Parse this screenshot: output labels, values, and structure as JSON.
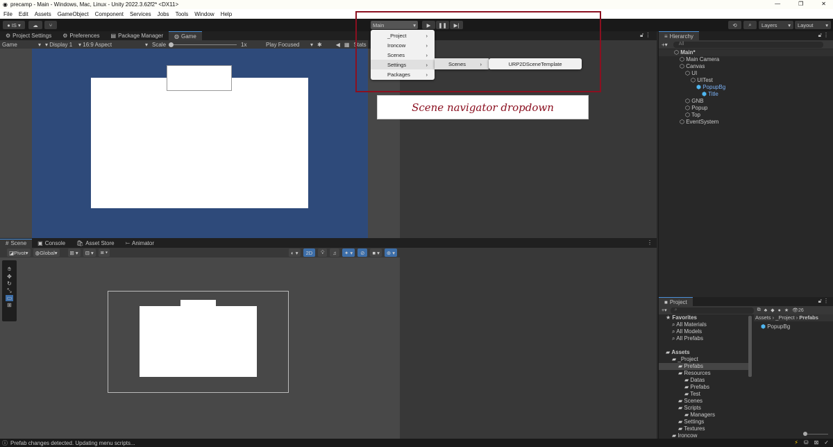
{
  "window": {
    "title": "precamp - Main - Windows, Mac, Linux - Unity 2022.3.62f2* <DX11>",
    "controls": [
      "—",
      "❐",
      "✕"
    ]
  },
  "menubar": [
    "File",
    "Edit",
    "Assets",
    "GameObject",
    "Component",
    "Services",
    "Jobs",
    "Tools",
    "Window",
    "Help"
  ],
  "toolbar": {
    "account": "IS",
    "scene_dropdown": "Main",
    "layers": "Layers",
    "layout": "Layout"
  },
  "top_tabs": [
    "Project Settings",
    "Preferences",
    "Package Manager",
    "Game"
  ],
  "game_toolbar": {
    "view": "Game",
    "display": "Display 1",
    "aspect": "16:9 Aspect",
    "scale_label": "Scale",
    "scale_value": "1x",
    "play_mode": "Play Focused",
    "stats": "Stats"
  },
  "scene_menu": {
    "items": [
      "_Project",
      "Ironcow",
      "Scenes",
      "Settings",
      "Packages"
    ],
    "highlighted": "Settings",
    "submenu": [
      "Scenes"
    ],
    "subsubmenu": [
      "URP2DSceneTemplate"
    ]
  },
  "annotation": {
    "label": "Scene navigator dropdown",
    "color": "#8b1020"
  },
  "hierarchy": {
    "title": "Hierarchy",
    "search_placeholder": "All",
    "items": [
      {
        "label": "Main*",
        "depth": 0,
        "bold": true
      },
      {
        "label": "Main Camera",
        "depth": 1
      },
      {
        "label": "Canvas",
        "depth": 1
      },
      {
        "label": "UI",
        "depth": 2
      },
      {
        "label": "UITest",
        "depth": 3
      },
      {
        "label": "PopupBg",
        "depth": 4,
        "prefab": true
      },
      {
        "label": "Title",
        "depth": 5,
        "prefab": true
      },
      {
        "label": "GNB",
        "depth": 2
      },
      {
        "label": "Popup",
        "depth": 2
      },
      {
        "label": "Top",
        "depth": 2
      },
      {
        "label": "EventSystem",
        "depth": 1
      }
    ]
  },
  "bottom_tabs": [
    "Scene",
    "Console",
    "Asset Store",
    "Animator"
  ],
  "scene_toolbar": {
    "pivot": "Pivot",
    "global": "Global",
    "mode_2d": "2D"
  },
  "project": {
    "title": "Project",
    "count": "26",
    "breadcrumb": [
      "Assets",
      "_Project",
      "Prefabs"
    ],
    "files": [
      "PopupBg"
    ],
    "tree": [
      {
        "label": "Favorites",
        "depth": 0,
        "bold": true
      },
      {
        "label": "All Materials",
        "depth": 1
      },
      {
        "label": "All Models",
        "depth": 1
      },
      {
        "label": "All Prefabs",
        "depth": 1
      },
      {
        "label": "",
        "depth": 0
      },
      {
        "label": "Assets",
        "depth": 0,
        "bold": true
      },
      {
        "label": "_Project",
        "depth": 1
      },
      {
        "label": "Prefabs",
        "depth": 2,
        "selected": true
      },
      {
        "label": "Resources",
        "depth": 2
      },
      {
        "label": "Datas",
        "depth": 3
      },
      {
        "label": "Prefabs",
        "depth": 3
      },
      {
        "label": "Test",
        "depth": 3
      },
      {
        "label": "Scenes",
        "depth": 2
      },
      {
        "label": "Scripts",
        "depth": 2
      },
      {
        "label": "Managers",
        "depth": 3
      },
      {
        "label": "Settings",
        "depth": 2
      },
      {
        "label": "Textures",
        "depth": 2
      },
      {
        "label": "Ironcow",
        "depth": 1
      }
    ]
  },
  "status": {
    "message": "Prefab changes detected. Updating menu scripts..."
  }
}
